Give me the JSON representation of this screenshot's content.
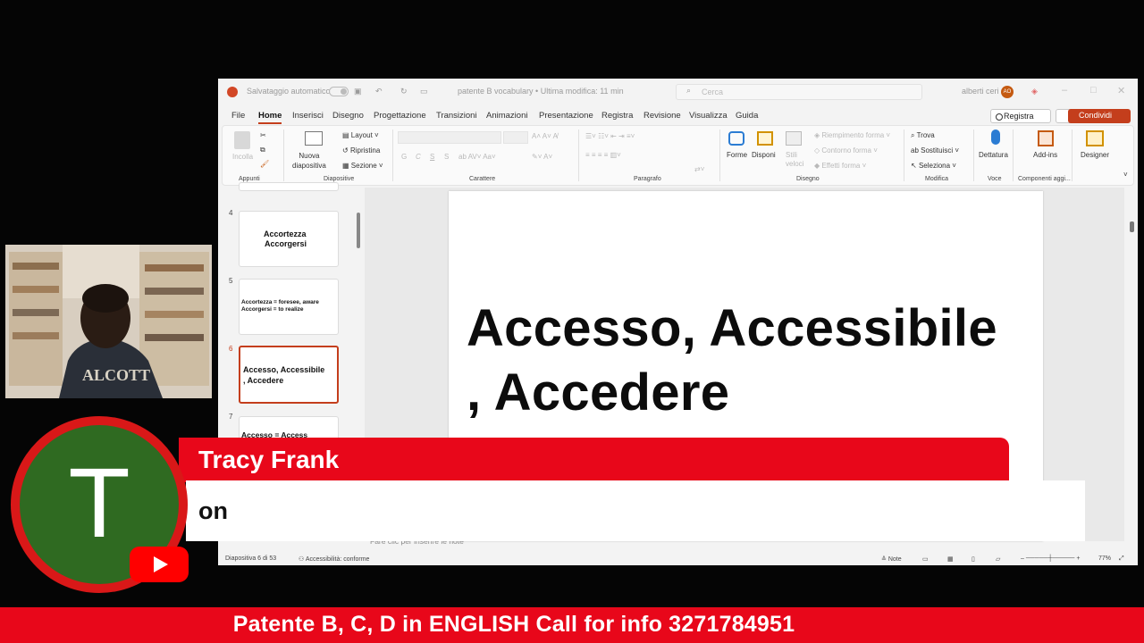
{
  "titlebar": {
    "autosave": "Salvataggio automatico",
    "filename": "patente B vocabulary • Ultima modifica: 11 min",
    "search_placeholder": "Cerca",
    "user": "alberti ceri",
    "user_initials": "AO"
  },
  "menu": {
    "tabs": [
      "File",
      "Home",
      "Inserisci",
      "Disegno",
      "Progettazione",
      "Transizioni",
      "Animazioni",
      "Presentazione",
      "Registra",
      "Revisione",
      "Visualizza",
      "Guida"
    ],
    "registra_button": "Registra",
    "share_button": "Condividi"
  },
  "ribbon": {
    "paste": "Incolla",
    "new_slide": "Nuova\ndiapositiva",
    "layout": "Layout",
    "reset": "Ripristina",
    "section": "Sezione",
    "bold": "G",
    "italic": "C",
    "underline": "S",
    "strike": "S",
    "shapes": "Forme",
    "arrange": "Disponi",
    "quick_styles": "Stili\nveloci",
    "shape_fill": "Riempimento forma",
    "shape_outline": "Contorno forma",
    "shape_effects": "Effetti forma",
    "find": "Trova",
    "replace": "Sostituisci",
    "select": "Seleziona",
    "dictation": "Dettatura",
    "addins": "Add-ins",
    "designer": "Designer",
    "groups": [
      "Appunti",
      "Diapositive",
      "Carattere",
      "Paragrafo",
      "Disegno",
      "Modifica",
      "Voce",
      "Componenti aggi..."
    ]
  },
  "thumbnails": [
    {
      "number": "4",
      "lines": [
        "Accortezza",
        "Accorgersi"
      ]
    },
    {
      "number": "5",
      "lines": [
        "Accortezza = foresee,  aware",
        "Accorgersi = to realize"
      ]
    },
    {
      "number": "6",
      "lines": [
        "Accesso, Accessibile",
        ", Accedere"
      ]
    },
    {
      "number": "7",
      "lines": [
        "Accesso = Access"
      ]
    }
  ],
  "slide": {
    "title_line1": "Accesso, Accessibile",
    "title_line2": ", Accedere"
  },
  "notes_placeholder": "Fare clic per inserire le note",
  "status": {
    "slide_counter": "Diapositiva 6 di 53",
    "accessibility": "Accessibilità: conforme",
    "notes": "Note",
    "zoom": "77%"
  },
  "comment": {
    "avatar_letter": "T",
    "author": "Tracy Frank",
    "text": "on"
  },
  "ticker": "Patente B, C, D in ENGLISH Call for info 3271784951",
  "colors": {
    "accent": "#c43e1c",
    "overlay_red": "#e8071a",
    "avatar_green": "#2f6a21"
  }
}
